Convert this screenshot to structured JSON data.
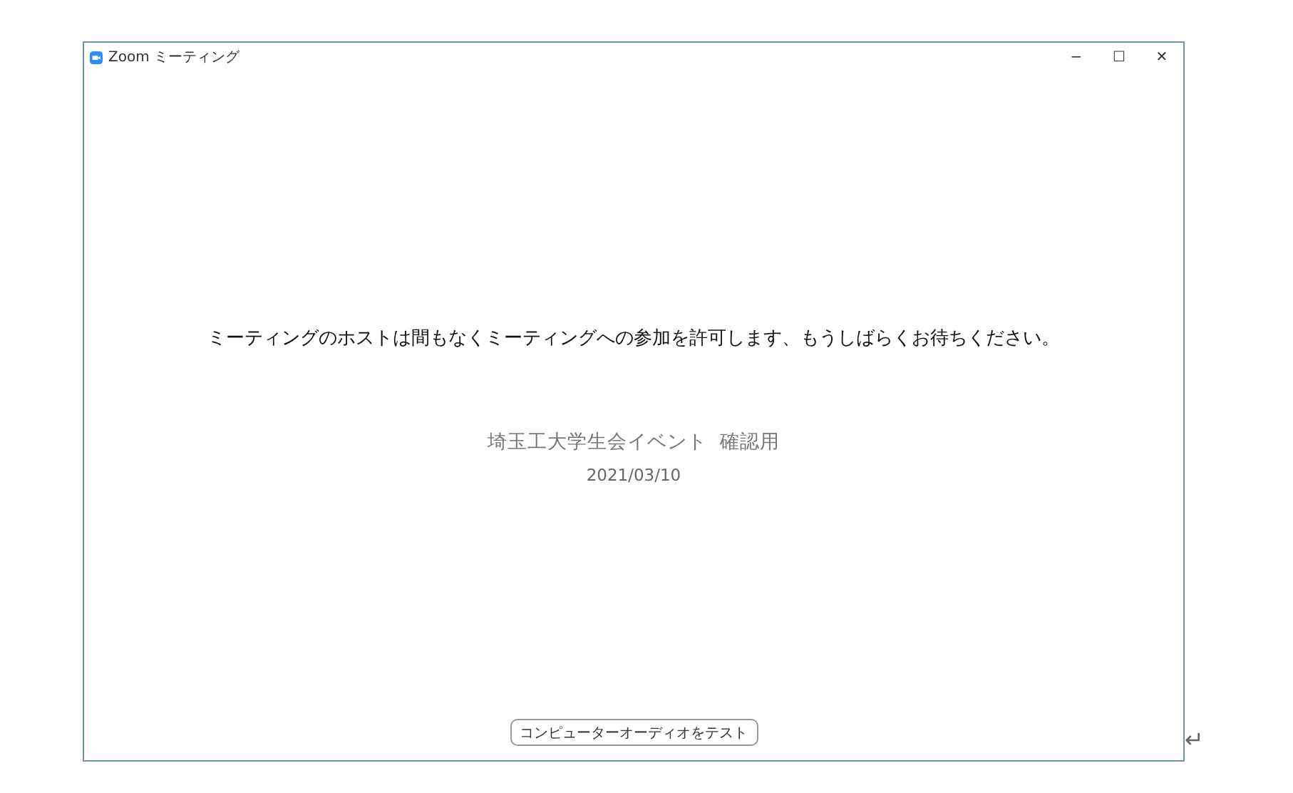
{
  "window": {
    "title": "Zoom ミーティング",
    "controls": [
      "−",
      "☐",
      "✕"
    ]
  },
  "message": "ミーティングのホストは間もなくミーティングへの参加を許可します、もうしばらくお待ちください。",
  "meeting": {
    "topic": "埼玉工大学生会イベント  確認用",
    "date": "2021/03/10"
  },
  "button": "コンピューターオーディオをテスト",
  "outside_mark": "↵"
}
